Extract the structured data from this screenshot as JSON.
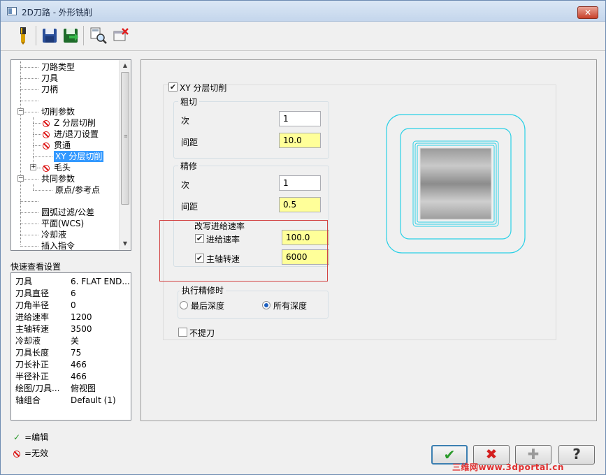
{
  "window": {
    "title": "2D刀路 - 外形铣削",
    "close_label": "✕"
  },
  "toolbar": {
    "icons": [
      "tool-icon",
      "save-icon",
      "save-green-icon",
      "find-icon",
      "delete-icon"
    ]
  },
  "tree": {
    "items": [
      {
        "label": "刀路类型"
      },
      {
        "label": "刀具"
      },
      {
        "label": "刀柄"
      },
      {
        "label": ""
      },
      {
        "label": "切削参数"
      },
      {
        "label": "Z 分层切削"
      },
      {
        "label": "进/退刀设置"
      },
      {
        "label": "贯通"
      },
      {
        "label": "XY 分层切削"
      },
      {
        "label": "毛头"
      },
      {
        "label": "共同参数"
      },
      {
        "label": "原点/参考点"
      },
      {
        "label": ""
      },
      {
        "label": "圆弧过滤/公差"
      },
      {
        "label": "平面(WCS)"
      },
      {
        "label": "冷却液"
      },
      {
        "label": "插入指令"
      }
    ]
  },
  "quick_view": {
    "title": "快速查看设置",
    "rows": [
      {
        "key": "刀具",
        "value": "6. FLAT END..."
      },
      {
        "key": "刀具直径",
        "value": "6"
      },
      {
        "key": "刀角半径",
        "value": "0"
      },
      {
        "key": "进给速率",
        "value": "1200"
      },
      {
        "key": "主轴转速",
        "value": "3500"
      },
      {
        "key": "冷却液",
        "value": "关"
      },
      {
        "key": "刀具长度",
        "value": "75"
      },
      {
        "key": "刀长补正",
        "value": "466"
      },
      {
        "key": "半径补正",
        "value": "466"
      },
      {
        "key": "绘图/刀具...",
        "value": "俯视图"
      },
      {
        "key": "轴组合",
        "value": "Default (1)"
      }
    ]
  },
  "legend": {
    "edit_label": "=编辑",
    "disabled_label": "=无效"
  },
  "xy_layers": {
    "enable_label": "XY 分层切削",
    "enabled": true,
    "rough": {
      "title": "粗切",
      "count_label": "次",
      "count_value": "1",
      "spacing_label": "间距",
      "spacing_value": "10.0"
    },
    "finish": {
      "title": "精修",
      "count_label": "次",
      "count_value": "1",
      "spacing_label": "间距",
      "spacing_value": "0.5",
      "override": {
        "title": "改写进给速率",
        "feed_label": "进给速率",
        "feed_checked": true,
        "feed_value": "100.0",
        "spindle_label": "主轴转速",
        "spindle_checked": true,
        "spindle_value": "6000"
      }
    },
    "finish_timing": {
      "title": "执行精修时",
      "option_last": "最后深度",
      "option_all": "所有深度",
      "selected": "所有深度"
    },
    "no_lift_label": "不提刀",
    "no_lift_checked": false
  },
  "buttons": {
    "ok": "✔",
    "cancel": "✖",
    "add": "✚",
    "help": "?"
  },
  "watermark": "三维网www.3dportal.cn",
  "colors": {
    "highlight": "#ffff99",
    "preview_line": "#2ad0e6",
    "selection": "#3399ff",
    "red_box": "#d24343"
  }
}
